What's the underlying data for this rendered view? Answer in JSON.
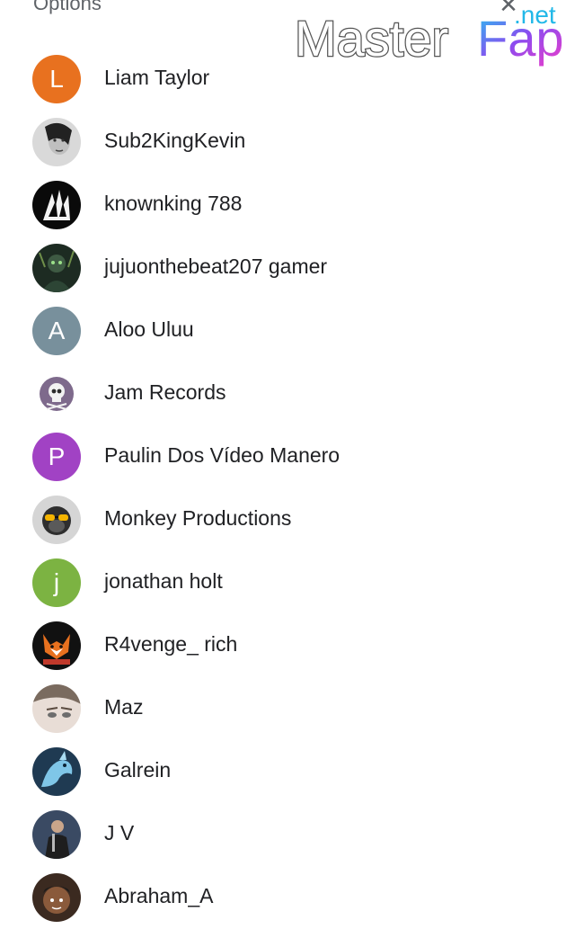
{
  "header": {
    "title": "Options"
  },
  "watermark": {
    "text_main": "Master",
    "text_accent": "Fap",
    "text_tld": ".net"
  },
  "contacts": [
    {
      "name": "Liam Taylor",
      "avatar": {
        "type": "initial",
        "initial": "L",
        "color": "#e8711f"
      }
    },
    {
      "name": "Sub2KingKevin",
      "avatar": {
        "type": "image",
        "icon": "face-photo-grey"
      }
    },
    {
      "name": "knownking 788",
      "avatar": {
        "type": "image",
        "icon": "eagle-bw"
      }
    },
    {
      "name": "jujuonthebeat207 gamer",
      "avatar": {
        "type": "image",
        "icon": "dark-gamer-art"
      }
    },
    {
      "name": "Aloo Uluu",
      "avatar": {
        "type": "initial",
        "initial": "A",
        "color": "#78909c"
      }
    },
    {
      "name": "Jam Records",
      "avatar": {
        "type": "image",
        "icon": "skull-logo"
      }
    },
    {
      "name": "Paulin Dos Vídeo Manero",
      "avatar": {
        "type": "initial",
        "initial": "P",
        "color": "#a142c4"
      }
    },
    {
      "name": "Monkey Productions",
      "avatar": {
        "type": "image",
        "icon": "monkey-sunglasses"
      }
    },
    {
      "name": "jonathan holt",
      "avatar": {
        "type": "initial",
        "initial": "j",
        "color": "#7cb342"
      }
    },
    {
      "name": "R4venge_ rich",
      "avatar": {
        "type": "image",
        "icon": "fox-logo"
      }
    },
    {
      "name": "Maz",
      "avatar": {
        "type": "image",
        "icon": "face-photo-light"
      }
    },
    {
      "name": "Galrein",
      "avatar": {
        "type": "image",
        "icon": "blue-dragon"
      }
    },
    {
      "name": "J V",
      "avatar": {
        "type": "image",
        "icon": "person-dark-photo"
      }
    },
    {
      "name": "Abraham_A",
      "avatar": {
        "type": "image",
        "icon": "cartoon-face"
      }
    }
  ]
}
